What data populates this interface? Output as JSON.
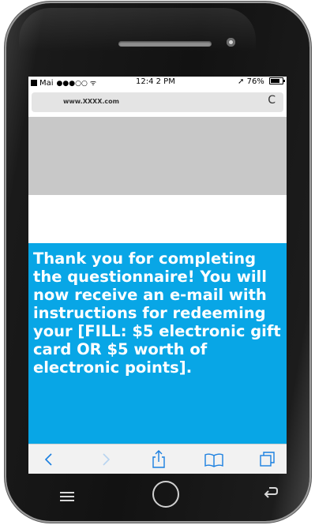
{
  "status_bar": {
    "carrier": "Mai",
    "signal": "●●●○○",
    "wifi": "ᯤ",
    "time": "12:4 2 PM",
    "location": "➚",
    "battery": "76%",
    "battery_level": 0.76
  },
  "browser": {
    "url": "www.XXXX.com",
    "reload_glyph": "C"
  },
  "message": "Thank you for completing the questionnaire! You will now receive an e-mail with instructions for redeeming your [FILL: $5 electronic gift card OR $5 worth of electronic points].",
  "toolbar": {
    "icons": [
      "back-icon",
      "forward-icon",
      "share-icon",
      "bookmarks-icon",
      "tabs-icon"
    ]
  },
  "hardware_buttons": [
    "menu-icon",
    "home-button",
    "return-icon"
  ],
  "colors": {
    "content_blue": "#08a6e6",
    "toolbar_icon_blue": "#1a7fe0",
    "forward_disabled": "#b8d4f0"
  }
}
